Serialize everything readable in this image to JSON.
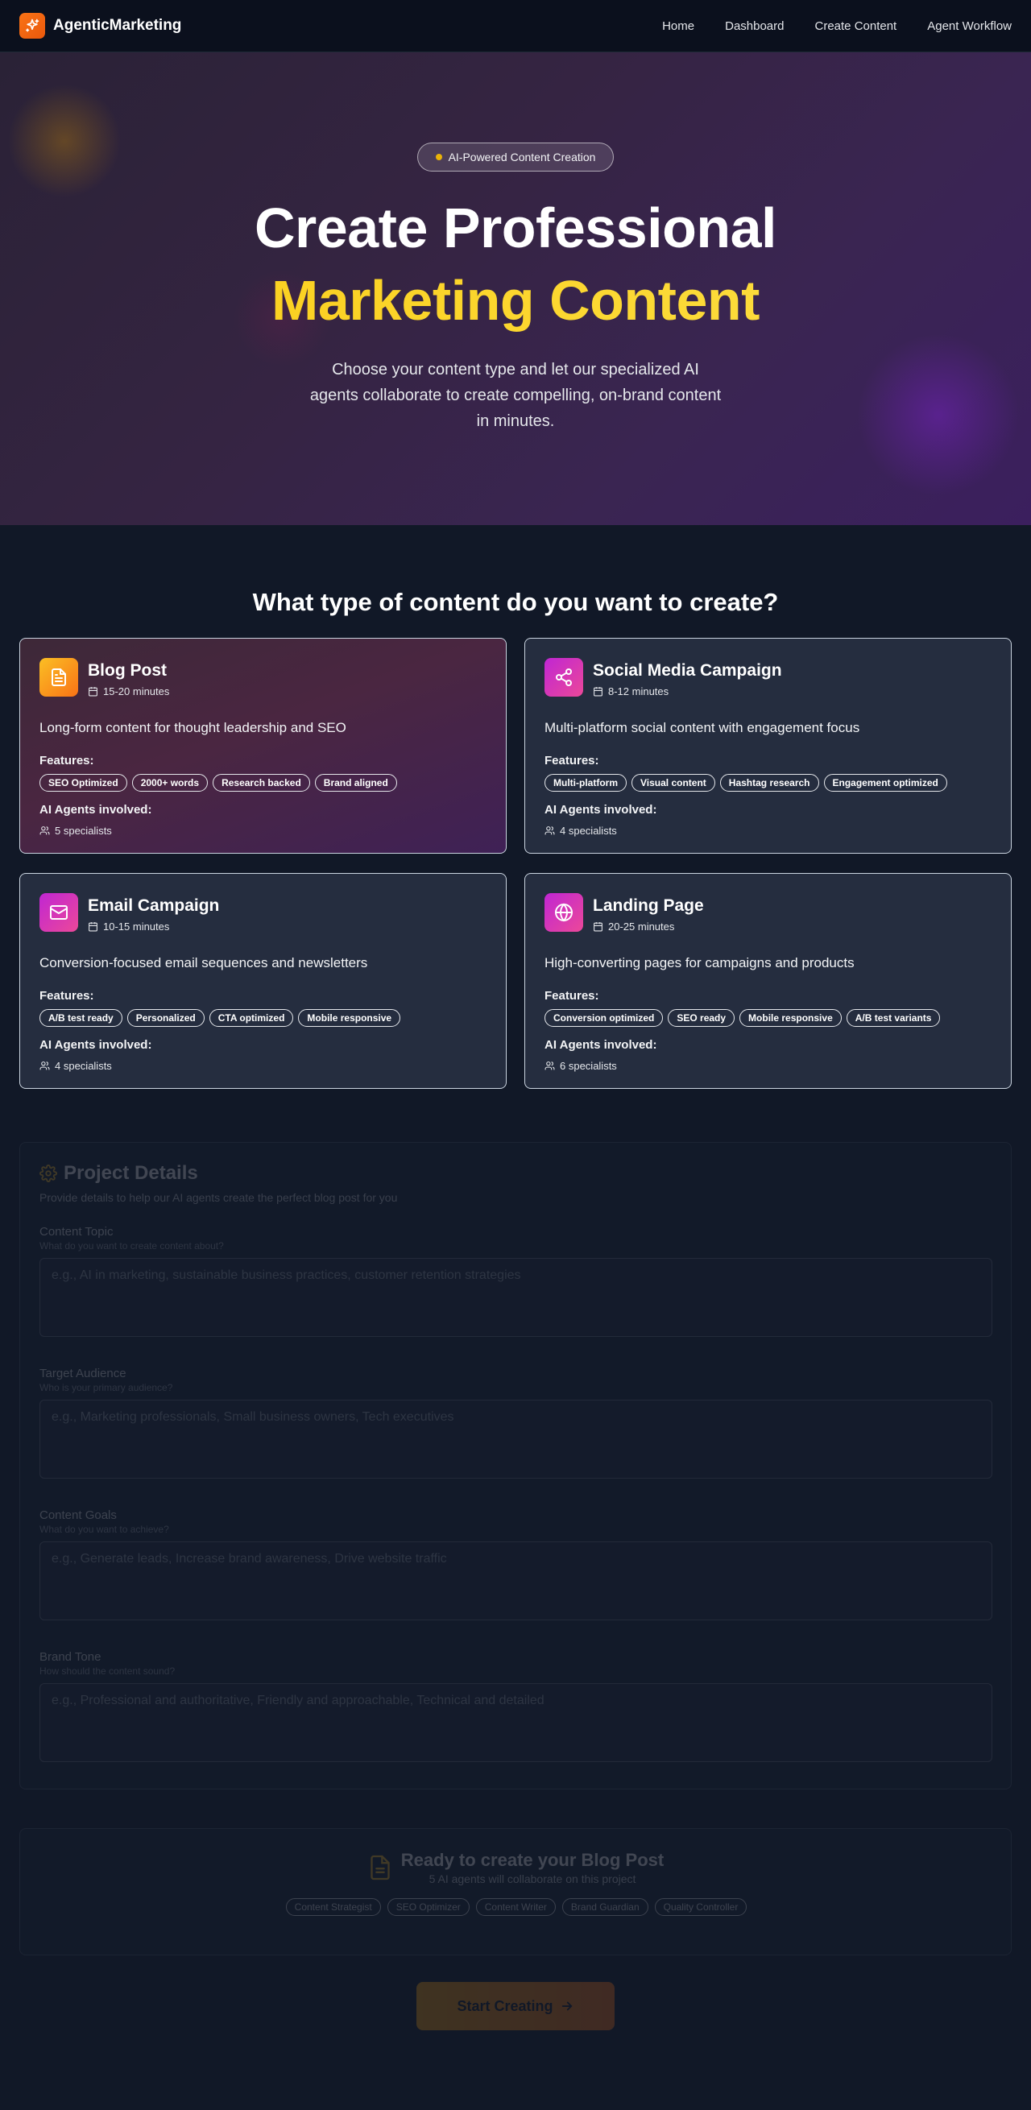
{
  "nav": {
    "brand": "AgenticMarketing",
    "links": [
      "Home",
      "Dashboard",
      "Create Content",
      "Agent Workflow"
    ]
  },
  "hero": {
    "badge": "AI-Powered Content Creation",
    "title_line1": "Create Professional",
    "title_line2": "Marketing Content",
    "subtitle": "Choose your content type and let our specialized AI agents collaborate to create compelling, on-brand content in minutes."
  },
  "section": {
    "title": "What type of content do you want to create?",
    "features_label": "Features:",
    "agents_label": "AI Agents involved:"
  },
  "cards": [
    {
      "title": "Blog Post",
      "time": "15-20 minutes",
      "description": "Long-form content for thought leadership and SEO",
      "features": [
        "SEO Optimized",
        "2000+ words",
        "Research backed",
        "Brand aligned"
      ],
      "agents": "5 specialists",
      "selected": true,
      "icon": "document-icon"
    },
    {
      "title": "Social Media Campaign",
      "time": "8-12 minutes",
      "description": "Multi-platform social content with engagement focus",
      "features": [
        "Multi-platform",
        "Visual content",
        "Hashtag research",
        "Engagement optimized"
      ],
      "agents": "4 specialists",
      "selected": false,
      "icon": "share-icon"
    },
    {
      "title": "Email Campaign",
      "time": "10-15 minutes",
      "description": "Conversion-focused email sequences and newsletters",
      "features": [
        "A/B test ready",
        "Personalized",
        "CTA optimized",
        "Mobile responsive"
      ],
      "agents": "4 specialists",
      "selected": false,
      "icon": "mail-icon"
    },
    {
      "title": "Landing Page",
      "time": "20-25 minutes",
      "description": "High-converting pages for campaigns and products",
      "features": [
        "Conversion optimized",
        "SEO ready",
        "Mobile responsive",
        "A/B test variants"
      ],
      "agents": "6 specialists",
      "selected": false,
      "icon": "globe-icon"
    }
  ],
  "details": {
    "title": "Project Details",
    "subtitle": "Provide details to help our AI agents create the perfect blog post for you",
    "fields": [
      {
        "label": "Content Topic",
        "help": "What do you want to create content about?",
        "placeholder": "e.g., AI in marketing, sustainable business practices, customer retention strategies"
      },
      {
        "label": "Target Audience",
        "help": "Who is your primary audience?",
        "placeholder": "e.g., Marketing professionals, Small business owners, Tech executives"
      },
      {
        "label": "Content Goals",
        "help": "What do you want to achieve?",
        "placeholder": "e.g., Generate leads, Increase brand awareness, Drive website traffic"
      },
      {
        "label": "Brand Tone",
        "help": "How should the content sound?",
        "placeholder": "e.g., Professional and authoritative, Friendly and approachable, Technical and detailed"
      }
    ]
  },
  "ready": {
    "title": "Ready to create your Blog Post",
    "subtitle": "5 AI agents will collaborate on this project",
    "agents": [
      "Content Strategist",
      "SEO Optimizer",
      "Content Writer",
      "Brand Guardian",
      "Quality Controller"
    ]
  },
  "cta": {
    "label": "Start Creating"
  },
  "colors": {
    "accent": "#f97316",
    "highlight": "#facc15",
    "background": "#111827"
  }
}
